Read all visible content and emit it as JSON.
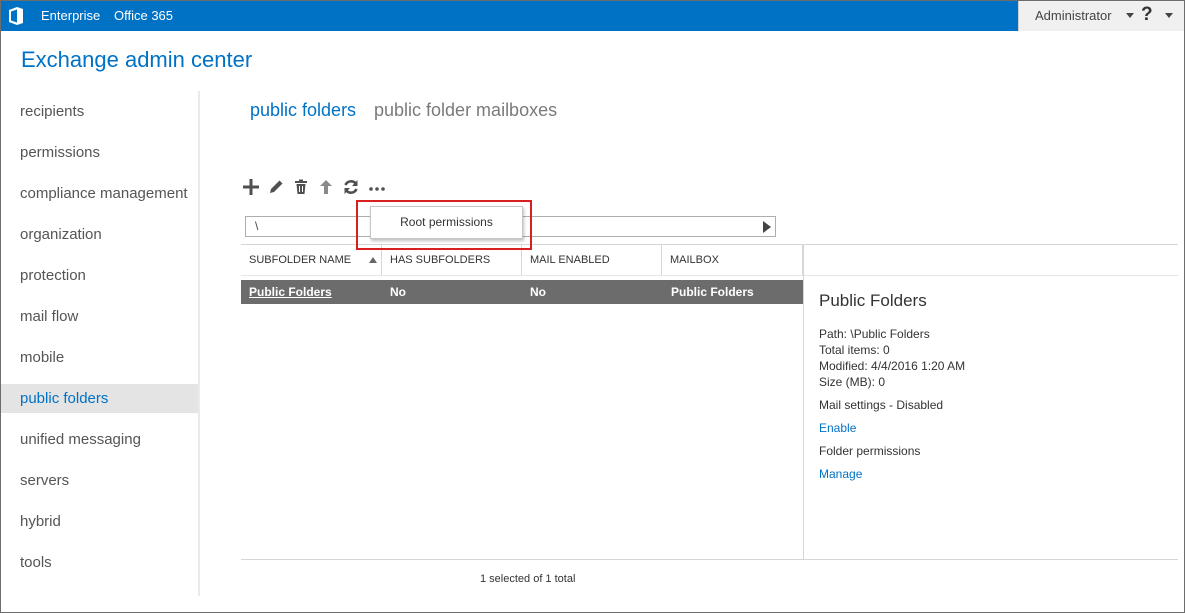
{
  "topbar": {
    "brand_color": "#0072c6",
    "logo_icon": "office-logo-icon",
    "links": [
      "Enterprise",
      "Office 365"
    ],
    "user_name": "Administrator",
    "help_label": "?"
  },
  "app": {
    "title": "Exchange admin center"
  },
  "sidebar": {
    "items": [
      {
        "label": "recipients"
      },
      {
        "label": "permissions"
      },
      {
        "label": "compliance management"
      },
      {
        "label": "organization"
      },
      {
        "label": "protection"
      },
      {
        "label": "mail flow"
      },
      {
        "label": "mobile"
      },
      {
        "label": "public folders",
        "selected": true
      },
      {
        "label": "unified messaging"
      },
      {
        "label": "servers"
      },
      {
        "label": "hybrid"
      },
      {
        "label": "tools"
      }
    ]
  },
  "tabs": [
    {
      "label": "public folders",
      "active": true
    },
    {
      "label": "public folder mailboxes",
      "active": false
    }
  ],
  "toolbar": {
    "icons": [
      "add-icon",
      "edit-icon",
      "delete-icon",
      "move-up-icon",
      "refresh-icon",
      "more-options-icon"
    ]
  },
  "path": {
    "value": "\\"
  },
  "dropdown": {
    "items": [
      "Root permissions"
    ],
    "highlight_color": "#d9201f"
  },
  "table": {
    "columns": [
      "SUBFOLDER NAME",
      "HAS SUBFOLDERS",
      "MAIL ENABLED",
      "MAILBOX"
    ],
    "sort_column": "SUBFOLDER NAME",
    "rows": [
      {
        "name": "Public Folders",
        "has_subfolders": "No",
        "mail_enabled": "No",
        "mailbox": "Public Folders",
        "selected": true
      }
    ],
    "status": "1 selected of 1 total"
  },
  "details": {
    "title": "Public Folders",
    "path": "Path: \\Public Folders",
    "total_items": "Total items: 0",
    "modified": "Modified: 4/4/2016 1:20 AM",
    "size": "Size (MB): 0",
    "mail_settings": "Mail settings - Disabled",
    "enable_link": "Enable",
    "folder_permissions": "Folder permissions",
    "manage_link": "Manage"
  }
}
